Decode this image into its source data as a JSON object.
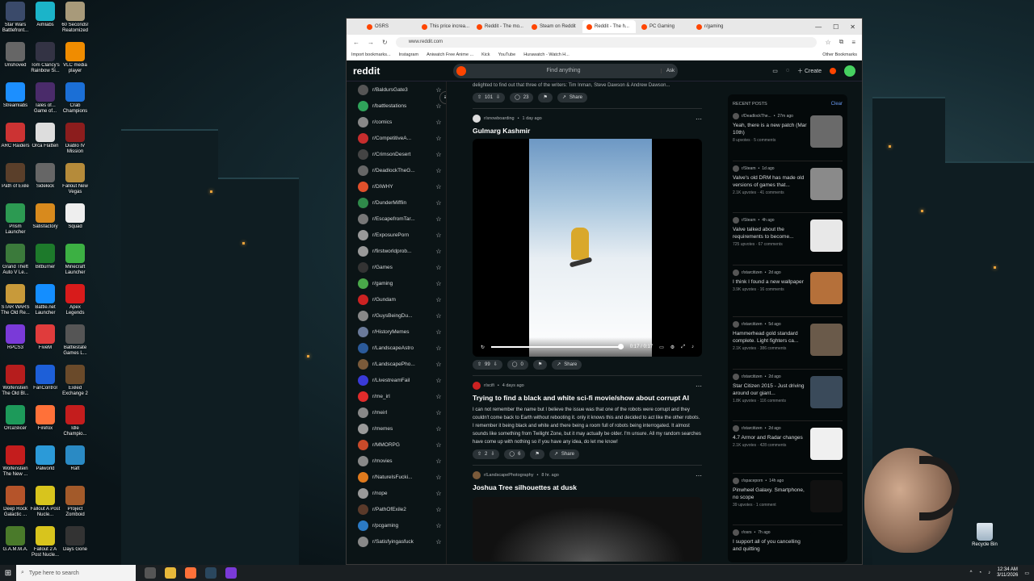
{
  "desktop": {
    "icons": [
      {
        "label": "Star Wars Battlefront...",
        "color": "#3a4a6a"
      },
      {
        "label": "Aimlabs",
        "color": "#1bb4c9"
      },
      {
        "label": "60 Seconds! Reatomized",
        "color": "#a89a7a"
      },
      {
        "label": "Unshoved",
        "color": "#666"
      },
      {
        "label": "Tom Clancy's Rainbow Si...",
        "color": "#334"
      },
      {
        "label": "VLC media player",
        "color": "#f08c00"
      },
      {
        "label": "Streamlabs",
        "color": "#1c8fff"
      },
      {
        "label": "Tales of... Game of...",
        "color": "#4a2b6a"
      },
      {
        "label": "Crab Champions",
        "color": "#1b6fd6"
      },
      {
        "label": "ARC Raiders",
        "color": "#c33"
      },
      {
        "label": "Orca Flatten",
        "color": "#ddd"
      },
      {
        "label": "Diablo IV Mission",
        "color": "#8c1d1d"
      },
      {
        "label": "Path of Exile",
        "color": "#5a3f2a"
      },
      {
        "label": "Sidekick",
        "color": "#666"
      },
      {
        "label": "Fallout New Vegas",
        "color": "#b58b3a"
      },
      {
        "label": "Prism Launcher",
        "color": "#2c9a52"
      },
      {
        "label": "Satisfactory",
        "color": "#d88a1d"
      },
      {
        "label": "Squad",
        "color": "#eee"
      },
      {
        "label": "Grand Theft Auto V Le...",
        "color": "#3b7a3b"
      },
      {
        "label": "Bitburner",
        "color": "#1d7a2b"
      },
      {
        "label": "Minecraft Launcher",
        "color": "#3cb043"
      },
      {
        "label": "STAR WARS The Old Re...",
        "color": "#c89a3a"
      },
      {
        "label": "Battle.net Launcher",
        "color": "#148eff"
      },
      {
        "label": "Apex Legends",
        "color": "#d81b1b"
      },
      {
        "label": "RPCS3",
        "color": "#7a3ad8"
      },
      {
        "label": "FiveM",
        "color": "#e03c3c"
      },
      {
        "label": "Battlestate Games L...",
        "color": "#555"
      },
      {
        "label": "Wolfenstein The Old Bl...",
        "color": "#b61d1d"
      },
      {
        "label": "FanControl",
        "color": "#1d5fd8"
      },
      {
        "label": "Exiled Exchange 2",
        "color": "#6a4a2a"
      },
      {
        "label": "OrcaSlicer",
        "color": "#1d9a5a"
      },
      {
        "label": "Firefox",
        "color": "#ff7139"
      },
      {
        "label": "Idle Champio...",
        "color": "#c41d1d"
      },
      {
        "label": "Wolfenstein The New ...",
        "color": "#c41d1d"
      },
      {
        "label": "Palworld",
        "color": "#2b9ad8"
      },
      {
        "label": "Raft",
        "color": "#2a8ac4"
      },
      {
        "label": "Deep Rock Galactic ...",
        "color": "#b5542a"
      },
      {
        "label": "Fallout A Post Nucle...",
        "color": "#d8c41d"
      },
      {
        "label": "Project Zomboid",
        "color": "#a35a2a"
      },
      {
        "label": "G.A.M.M.A.",
        "color": "#4a7a2a"
      },
      {
        "label": "Fallout 2 A Post Nucle...",
        "color": "#d8c41d"
      },
      {
        "label": "Days Gone",
        "color": "#333"
      }
    ],
    "recycle_bin": "Recycle Bin"
  },
  "browser": {
    "tabs": [
      {
        "label": "OSRS",
        "active": false
      },
      {
        "label": "This price increa...",
        "active": false
      },
      {
        "label": "Reddit - The mo...",
        "active": false
      },
      {
        "label": "Steam on Reddit",
        "active": false
      },
      {
        "label": "Reddit - The h...",
        "active": true
      },
      {
        "label": "PC Gaming",
        "active": false
      },
      {
        "label": "r/gaming",
        "active": false
      }
    ],
    "url": "www.reddit.com",
    "bookmarks": [
      "Import bookmarks...",
      "Instagram",
      "Aniwatch Free Anime ...",
      "Kick",
      "YouTube",
      "Hurawatch - Watch H..."
    ],
    "other_bookmarks": "Other Bookmarks"
  },
  "reddit": {
    "logo": "reddit",
    "search_placeholder": "Find anything",
    "ask_label": "Ask",
    "create_label": "Create",
    "sidebar": [
      {
        "name": "r/BaldursGate3",
        "color": "#555"
      },
      {
        "name": "r/battlestations",
        "color": "#2fa35a"
      },
      {
        "name": "r/comics",
        "color": "#888"
      },
      {
        "name": "r/CompetitiveA...",
        "color": "#c62d2d"
      },
      {
        "name": "r/CrimsonDesert",
        "color": "#444"
      },
      {
        "name": "r/DeadlockTheG...",
        "color": "#666"
      },
      {
        "name": "r/DIWHY",
        "color": "#e0502b"
      },
      {
        "name": "r/DunderMifflin",
        "color": "#2f8a4a"
      },
      {
        "name": "r/EscapefromTar...",
        "color": "#777"
      },
      {
        "name": "r/ExposurePorn",
        "color": "#999"
      },
      {
        "name": "r/firstworldprob...",
        "color": "#999"
      },
      {
        "name": "r/Games",
        "color": "#333"
      },
      {
        "name": "r/gaming",
        "color": "#4aa84a"
      },
      {
        "name": "r/Gundam",
        "color": "#c22"
      },
      {
        "name": "r/GuysBeingDu...",
        "color": "#888"
      },
      {
        "name": "r/HistoryMemes",
        "color": "#6a7a9a"
      },
      {
        "name": "r/LandscapeAstro",
        "color": "#2b5a9a"
      },
      {
        "name": "r/LandscapePho...",
        "color": "#7a5a3a"
      },
      {
        "name": "r/LivestreamFail",
        "color": "#3a3ad8"
      },
      {
        "name": "r/me_irl",
        "color": "#e02b2b"
      },
      {
        "name": "r/meirl",
        "color": "#888"
      },
      {
        "name": "r/memes",
        "color": "#999"
      },
      {
        "name": "r/MMORPG",
        "color": "#c84a2a"
      },
      {
        "name": "r/movies",
        "color": "#888"
      },
      {
        "name": "r/NatureIsFucki...",
        "color": "#e07a1d"
      },
      {
        "name": "r/nope",
        "color": "#999"
      },
      {
        "name": "r/PathOfExile2",
        "color": "#5a3a2a"
      },
      {
        "name": "r/pcgaming",
        "color": "#2b7ac4"
      },
      {
        "name": "r/Satisfyingasfuck",
        "color": "#888"
      }
    ],
    "feed": {
      "snippet": "delighted to find out that three of the writers: Tim Inman, Steve Dawson & Andrew Dawson...",
      "snippet_actions": {
        "votes": "101",
        "comments": "23",
        "share": "Share"
      },
      "posts": [
        {
          "subreddit": "r/snowboarding",
          "age": "1 day ago",
          "title": "Gulmarg Kashmir",
          "video_time": "0:17 / 0:17",
          "video_progress": 1.0,
          "votes": "99",
          "comments": "0",
          "share": "Share"
        },
        {
          "subreddit": "r/scifi",
          "age": "4 days ago",
          "title": "Trying to find a black and white sci-fi movie/show about corrupt AI",
          "body": "I can not remember the name but I believe the issue was that one of the robots were corrupt and they couldn't come back to Earth without rebooting it. only it knows this and decided to act like the other robots. I remember it being black and white and there being a room full of robots being interrogated. It almost sounds like something from Twilight Zone, but it may actually be older. I'm unsure. All my random searches have come up with nothing so if you have any idea, do let me know!",
          "votes": "2",
          "comments": "6",
          "share": "Share"
        },
        {
          "subreddit": "r/LandscapePhotography",
          "age": "8 hr. ago",
          "title": "Joshua Tree silhouettes at dusk"
        }
      ]
    },
    "recent": {
      "heading": "RECENT POSTS",
      "clear": "Clear",
      "items": [
        {
          "sub": "r/DeadlockThe...",
          "age": "27m ago",
          "title": "Yeah, there is a new patch (Mar 10th)",
          "stats": "8 upvotes · 5 comments",
          "thumb": "#6a6a6a"
        },
        {
          "sub": "r/Steam",
          "age": "1d ago",
          "title": "Valve's old DRM has made old versions of games that...",
          "stats": "2.1K upvotes · 41 comments",
          "thumb": "#8a8a8a"
        },
        {
          "sub": "r/Steam",
          "age": "4h ago",
          "title": "Valve talked about the requirements to become...",
          "stats": "725 upvotes · 67 comments",
          "thumb": "#e8e8e8"
        },
        {
          "sub": "r/starcitizen",
          "age": "2d ago",
          "title": "I think I found a new wallpaper",
          "stats": "3.9K upvotes · 16 comments",
          "thumb": "#b5703a"
        },
        {
          "sub": "r/starcitizen",
          "age": "5d ago",
          "title": "Hammerhead gold standard complete. Light fighters ca...",
          "stats": "2.1K upvotes · 386 comments",
          "thumb": "#6a5a4a"
        },
        {
          "sub": "r/starcitizen",
          "age": "2d ago",
          "title": "Star Citizen 2015 - Just driving around our giant...",
          "stats": "1.8K upvotes · 116 comments",
          "thumb": "#3a4a5a"
        },
        {
          "sub": "r/starcitizen",
          "age": "2d ago",
          "title": "4.7 Armor and Radar changes",
          "stats": "2.1K upvotes · 428 comments",
          "thumb": "#f0f0f0"
        },
        {
          "sub": "r/spaceporn",
          "age": "14h ago",
          "title": "Pinwheel Galaxy. Smartphone, no scope",
          "stats": "39 upvotes · 1 comment",
          "thumb": "#111"
        },
        {
          "sub": "r/osrs",
          "age": "7h ago",
          "title": "I support all of you cancelling and quitting",
          "stats": "",
          "thumb": "#04090a"
        }
      ]
    }
  },
  "taskbar": {
    "search_placeholder": "Type here to search",
    "time": "12:34 AM",
    "date": "3/11/2026"
  }
}
